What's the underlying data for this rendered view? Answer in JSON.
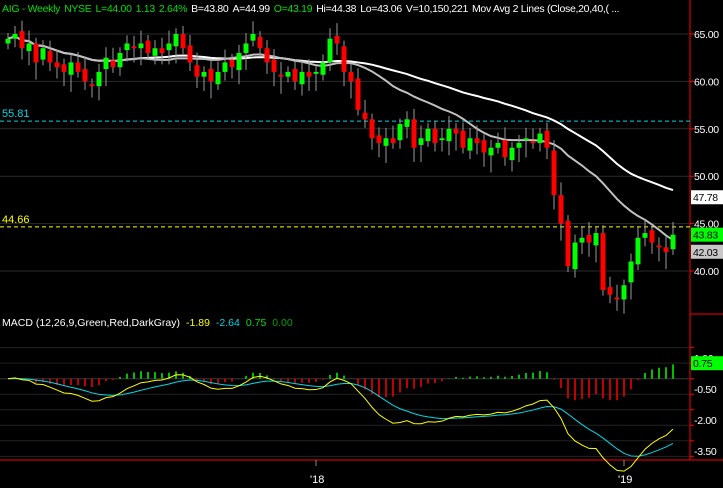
{
  "header": {
    "symbol": "AIG - Weekly",
    "exchange": "NYSE",
    "last": "L=44.00",
    "change": "1.13",
    "pct": "2.64%",
    "bid": "B=43.80",
    "ask": "A=44.99",
    "open": "O=43.19",
    "high": "Hi=44.38",
    "low": "Lo=43.06",
    "volume": "V=10,150,221",
    "ma": "Mov Avg 2 Lines (Close,20,40,( ..."
  },
  "macd_header": {
    "label": "MACD (12,26,9,Green,Red,DarkGray)",
    "macd": "-1.89",
    "signal": "-2.64",
    "hist": "0.75",
    "zero": "0.00"
  },
  "colors": {
    "up": "#00ff00",
    "down": "#ff0000",
    "wick": "#9a9a9a",
    "axis": "#ff0000",
    "ma20": "#c0c0c0",
    "ma40": "#ffffff",
    "macd": "#ffff00",
    "signal": "#00d8e8",
    "level_high": "#00d8e8",
    "level_low": "#ffff00"
  },
  "chart_data": [
    {
      "type": "candlestick",
      "title": "AIG - Weekly",
      "ylim": [
        35,
        67
      ],
      "yticks": [
        "65.00",
        "60.00",
        "55.00",
        "50.00",
        "45.00",
        "40.00"
      ],
      "ytick_values": [
        65,
        60,
        55,
        50,
        45,
        40
      ],
      "xticks": [
        "'18",
        "'19"
      ],
      "xtick_index": [
        44,
        88
      ],
      "closes": [
        64.5,
        65,
        63.5,
        64,
        62,
        63.5,
        62,
        61.5,
        61,
        62,
        61,
        60,
        59.5,
        61,
        62.5,
        61.5,
        63,
        64,
        63.5,
        64,
        63,
        63.5,
        63,
        64,
        65,
        63.5,
        62,
        60.5,
        61,
        60,
        61,
        62,
        61.5,
        63,
        64,
        65,
        63.5,
        62,
        61,
        60.5,
        61,
        60,
        61,
        60.5,
        61,
        62,
        64.5,
        64,
        61,
        60,
        57,
        56,
        54,
        53.5,
        54,
        53.5,
        55.5,
        56,
        53,
        54,
        55,
        53.5,
        54,
        55,
        54.5,
        53,
        54,
        53.5,
        52.5,
        53,
        53.5,
        52,
        53,
        53.5,
        54,
        53.5,
        54.5,
        53,
        48,
        45,
        40.5,
        43,
        43.5,
        43,
        44,
        38,
        37.5,
        37,
        38.5,
        41,
        43.5,
        44,
        43,
        42.5,
        42,
        43.83
      ],
      "levels": [
        {
          "value": 55.81,
          "label": "55.81"
        },
        {
          "value": 44.66,
          "label": "44.66"
        }
      ],
      "price_labels": [
        {
          "label": "47.78",
          "series": "MA40"
        },
        {
          "label": "43.83",
          "series": "Last"
        },
        {
          "label": "42.03",
          "series": "MA20"
        }
      ],
      "series": [
        {
          "name": "MA20",
          "period": 20
        },
        {
          "name": "MA40",
          "period": 40
        }
      ]
    },
    {
      "type": "macd",
      "params": [
        12,
        26,
        9
      ],
      "ylim": [
        -4.2,
        2.2
      ],
      "yticks": [
        "1.00",
        "-0.50",
        "-2.00",
        "-3.50"
      ],
      "ytick_values": [
        1,
        -0.5,
        -2,
        -3.5
      ],
      "hist_label": "0.75"
    }
  ]
}
